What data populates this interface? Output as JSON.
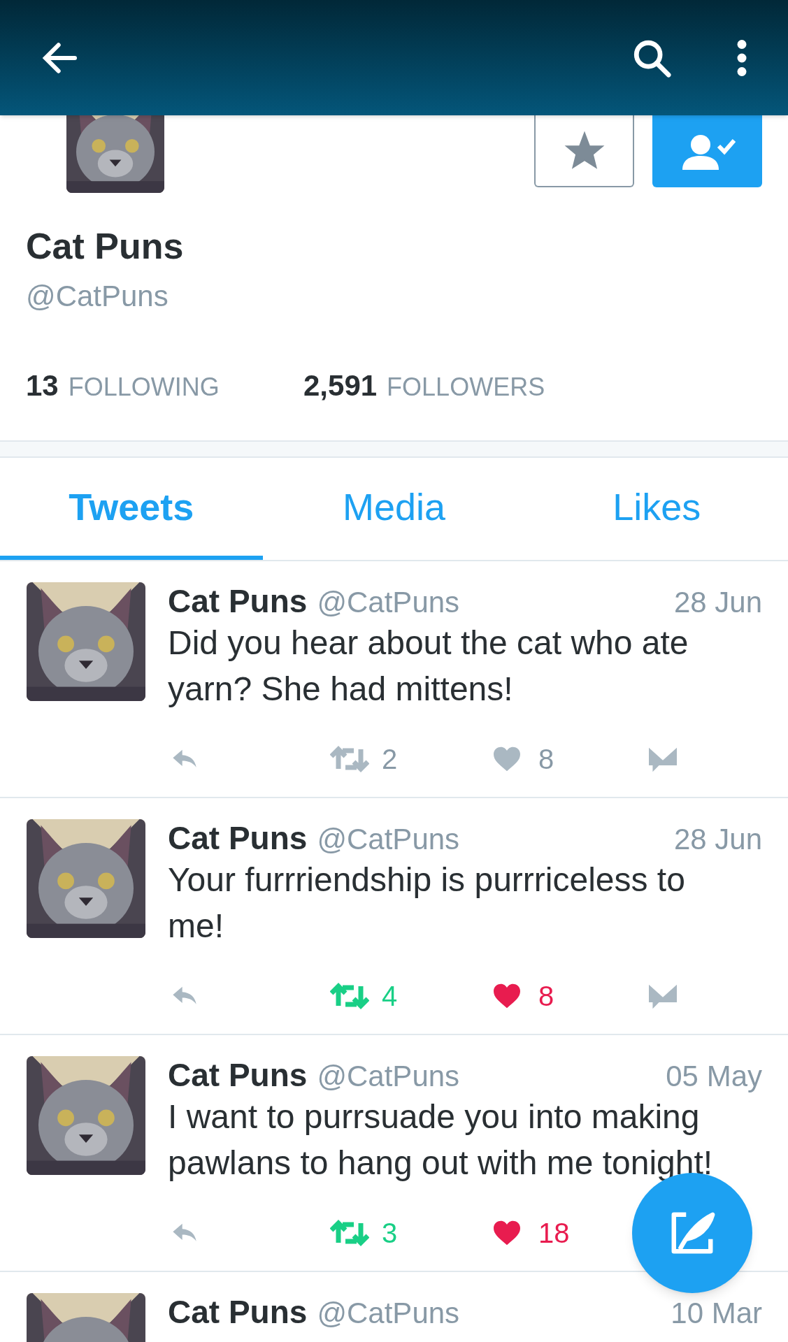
{
  "profile": {
    "name": "Cat Puns",
    "handle": "@CatPuns",
    "favorited": false,
    "following": true
  },
  "stats": [
    {
      "count": "13",
      "label": "FOLLOWING"
    },
    {
      "count": "2,591",
      "label": "FOLLOWERS"
    }
  ],
  "tabs": [
    {
      "label": "Tweets",
      "selected": true
    },
    {
      "label": "Media",
      "selected": false
    },
    {
      "label": "Likes",
      "selected": false
    }
  ],
  "tweets": [
    {
      "name": "Cat Puns",
      "handle": "@CatPuns",
      "date": "28 Jun",
      "text": "Did you hear about the cat who ate yarn? She had mittens!",
      "retweets": "2",
      "retweeted": false,
      "likes": "8",
      "liked": false,
      "message_button": true
    },
    {
      "name": "Cat Puns",
      "handle": "@CatPuns",
      "date": "28 Jun",
      "text": "Your furrriendship is purrriceless to me!",
      "retweets": "4",
      "retweeted": true,
      "likes": "8",
      "liked": true,
      "message_button": true
    },
    {
      "name": "Cat Puns",
      "handle": "@CatPuns",
      "date": "05 May",
      "text": "I want to purrsuade you into making pawlans to hang out with me tonight!",
      "retweets": "3",
      "retweeted": true,
      "likes": "18",
      "liked": true,
      "message_button": false
    },
    {
      "name": "Cat Puns",
      "handle": "@CatPuns",
      "date": "10 Mar"
    }
  ]
}
